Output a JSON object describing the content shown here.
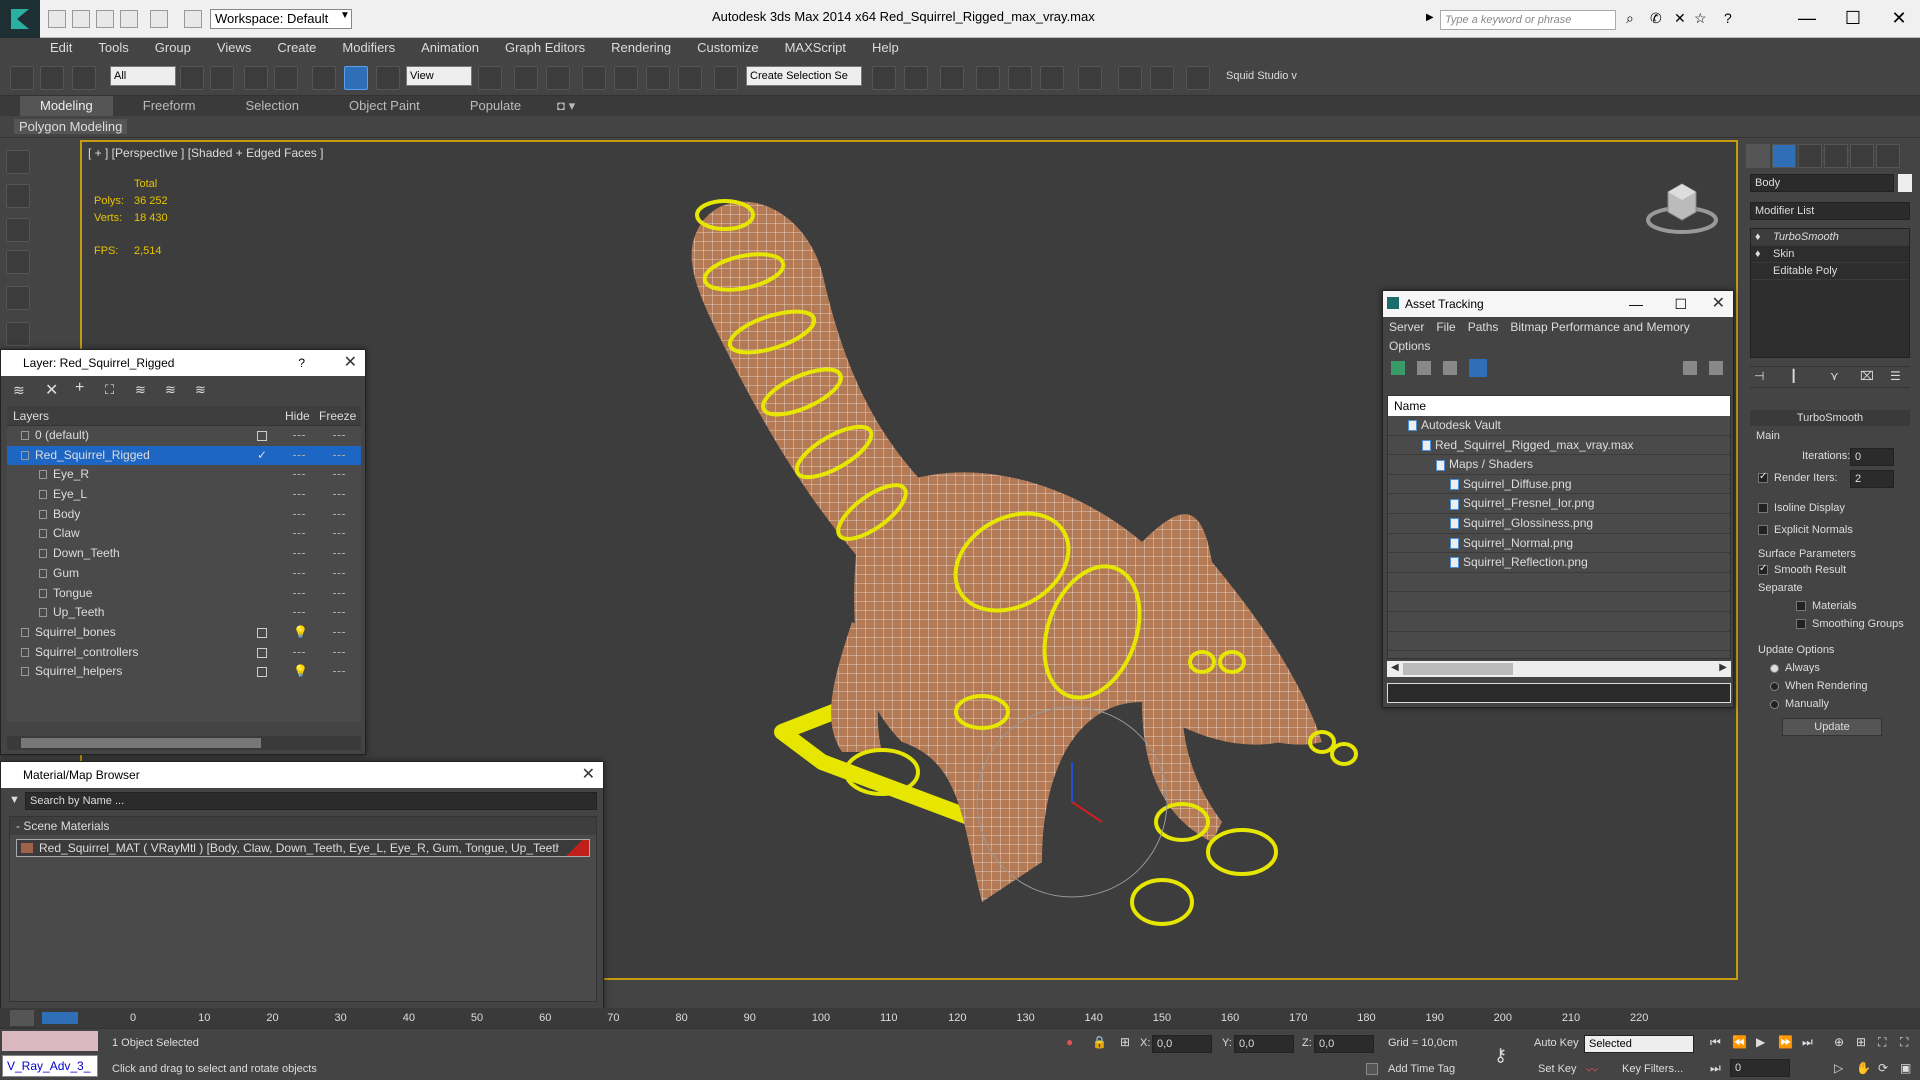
{
  "title_bar": {
    "workspace": "Workspace: Default",
    "app_title": "Autodesk 3ds Max  2014 x64      Red_Squirrel_Rigged_max_vray.max",
    "search_placeholder": "Type a keyword or phrase"
  },
  "menu": [
    "Edit",
    "Tools",
    "Group",
    "Views",
    "Create",
    "Modifiers",
    "Animation",
    "Graph Editors",
    "Rendering",
    "Customize",
    "MAXScript",
    "Help"
  ],
  "toolbar": {
    "filter": "All",
    "ref_coord": "View",
    "selection_set": "Create Selection Se",
    "studio": "Squid Studio v"
  },
  "ribbon": {
    "tabs": [
      "Modeling",
      "Freeform",
      "Selection",
      "Object Paint",
      "Populate"
    ],
    "active": "Modeling",
    "sub": "Polygon Modeling"
  },
  "viewport": {
    "label": "[ + ] [Perspective ] [Shaded + Edged Faces ]",
    "stats": {
      "header": "Total",
      "polys_label": "Polys:",
      "polys": "36 252",
      "verts_label": "Verts:",
      "verts": "18 430",
      "fps_label": "FPS:",
      "fps": "2,514"
    }
  },
  "layer_window": {
    "title": "Layer: Red_Squirrel_Rigged",
    "help": "?",
    "columns": [
      "Layers",
      "Hide",
      "Freeze"
    ],
    "rows": [
      {
        "name": "0 (default)",
        "indent": 0,
        "hide_box": true,
        "light": false
      },
      {
        "name": "Red_Squirrel_Rigged",
        "indent": 0,
        "selected": true,
        "check": true
      },
      {
        "name": "Eye_R",
        "indent": 1
      },
      {
        "name": "Eye_L",
        "indent": 1
      },
      {
        "name": "Body",
        "indent": 1
      },
      {
        "name": "Claw",
        "indent": 1
      },
      {
        "name": "Down_Teeth",
        "indent": 1
      },
      {
        "name": "Gum",
        "indent": 1
      },
      {
        "name": "Tongue",
        "indent": 1
      },
      {
        "name": "Up_Teeth",
        "indent": 1
      },
      {
        "name": "Squirrel_bones",
        "indent": 0,
        "hide_box": true,
        "light": true
      },
      {
        "name": "Squirrel_controllers",
        "indent": 0,
        "hide_box": true,
        "light": false
      },
      {
        "name": "Squirrel_helpers",
        "indent": 0,
        "hide_box": true,
        "light": true
      }
    ]
  },
  "material_window": {
    "title": "Material/Map Browser",
    "search": "Search by Name ...",
    "section": "- Scene Materials",
    "item": "Red_Squirrel_MAT  ( VRayMtl ) [Body, Claw, Down_Teeth, Eye_L, Eye_R, Gum, Tongue, Up_Teeth]"
  },
  "asset_window": {
    "title": "Asset Tracking",
    "menu": [
      "Server",
      "File",
      "Paths",
      "Bitmap Performance and Memory"
    ],
    "menu2": "Options",
    "column": "Name",
    "rows": [
      {
        "name": "Autodesk Vault",
        "indent": 0
      },
      {
        "name": "Red_Squirrel_Rigged_max_vray.max",
        "indent": 1
      },
      {
        "name": "Maps / Shaders",
        "indent": 2
      },
      {
        "name": "Squirrel_Diffuse.png",
        "indent": 3
      },
      {
        "name": "Squirrel_Fresnel_Ior.png",
        "indent": 3
      },
      {
        "name": "Squirrel_Glossiness.png",
        "indent": 3
      },
      {
        "name": "Squirrel_Normal.png",
        "indent": 3
      },
      {
        "name": "Squirrel_Reflection.png",
        "indent": 3
      }
    ]
  },
  "command_panel": {
    "object_name": "Body",
    "modifier_list": "Modifier List",
    "stack": [
      "TurboSmooth",
      "Skin",
      "Editable Poly"
    ],
    "rollout": "TurboSmooth",
    "main": "Main",
    "iterations_label": "Iterations:",
    "iterations": "0",
    "render_iters_label": "Render Iters:",
    "render_iters": "2",
    "isoline": "Isoline Display",
    "explicit": "Explicit Normals",
    "surface": "Surface Parameters",
    "smooth_result": "Smooth Result",
    "separate": "Separate",
    "materials": "Materials",
    "smoothing_groups": "Smoothing Groups",
    "update_options": "Update Options",
    "always": "Always",
    "when_rendering": "When Rendering",
    "manually": "Manually",
    "update_btn": "Update"
  },
  "timeline": {
    "ticks": [
      "0",
      "10",
      "20",
      "30",
      "40",
      "50",
      "60",
      "70",
      "80",
      "90",
      "100",
      "110",
      "120",
      "130",
      "140",
      "150",
      "160",
      "170",
      "180",
      "190",
      "200",
      "210",
      "220"
    ]
  },
  "status": {
    "script_box": "V_Ray_Adv_3_",
    "selected": "1 Object Selected",
    "prompt": "Click and drag to select and rotate objects",
    "x_label": "X:",
    "x": "0,0",
    "y_label": "Y:",
    "y": "0,0",
    "z_label": "Z:",
    "z": "0,0",
    "grid": "Grid = 10,0cm",
    "add_time_tag": "Add Time Tag",
    "auto_key": "Auto Key",
    "set_key": "Set Key",
    "key_mode": "Selected",
    "key_filters": "Key Filters...",
    "frame": "0"
  },
  "colors": {
    "accent": "#e6c300",
    "selection": "#1e66c4",
    "viewport_border": "#c59b12"
  }
}
